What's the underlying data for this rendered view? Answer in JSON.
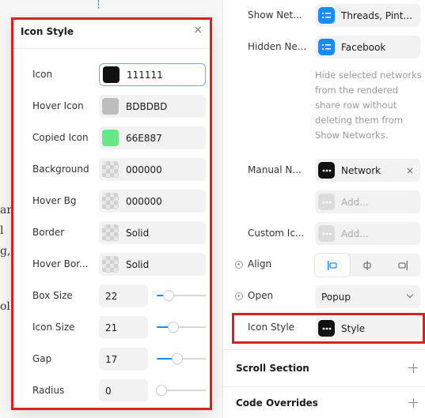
{
  "popup": {
    "title": "Icon Style",
    "close_glyph": "×",
    "color_rows": [
      {
        "label": "Icon",
        "value": "111111",
        "swatch": "#111111",
        "checker": false,
        "focused": true
      },
      {
        "label": "Hover Icon",
        "value": "BDBDBD",
        "swatch": "#BDBDBD",
        "checker": false,
        "focused": false
      },
      {
        "label": "Copied Icon",
        "value": "66E887",
        "swatch": "#66E887",
        "checker": false,
        "focused": false
      },
      {
        "label": "Background",
        "value": "000000",
        "swatch": "checker",
        "checker": true,
        "focused": false
      },
      {
        "label": "Hover Bg",
        "value": "000000",
        "swatch": "checker",
        "checker": true,
        "focused": false
      },
      {
        "label": "Border",
        "value": "Solid",
        "swatch": "checker",
        "checker": true,
        "focused": false
      },
      {
        "label": "Hover Bor...",
        "value": "Solid",
        "swatch": "checker",
        "checker": true,
        "focused": false
      }
    ],
    "number_rows": [
      {
        "label": "Box Size",
        "value": "22",
        "fraction": 0.18
      },
      {
        "label": "Icon Size",
        "value": "21",
        "fraction": 0.3
      },
      {
        "label": "Gap",
        "value": "17",
        "fraction": 0.4
      },
      {
        "label": "Radius",
        "value": "0",
        "fraction": 0.0
      }
    ]
  },
  "panel": {
    "show_networks": {
      "label": "Show Net...",
      "value": "Threads, Pint..."
    },
    "hidden_networks": {
      "label": "Hidden Ne...",
      "value": "Facebook"
    },
    "help_text": "Hide selected networks from the rendered share row without deleting them from Show Networks.",
    "manual_networks": {
      "label": "Manual N...",
      "value": "Network",
      "remove_glyph": "×",
      "add_placeholder": "Add..."
    },
    "custom_icons": {
      "label": "Custom Ic...",
      "add_placeholder": "Add..."
    },
    "align": {
      "label": "Align",
      "selected_index": 0
    },
    "open": {
      "label": "Open",
      "value": "Popup"
    },
    "icon_style": {
      "label": "Icon Style",
      "value": "Style"
    },
    "sections": [
      {
        "title": "Scroll Section"
      },
      {
        "title": "Code Overrides"
      }
    ]
  },
  "backdrop": {
    "fragments": [
      "ar",
      "l",
      "g,",
      "ol"
    ]
  },
  "colors": {
    "accent": "#1a8cff",
    "annotation_red": "#d62222"
  }
}
